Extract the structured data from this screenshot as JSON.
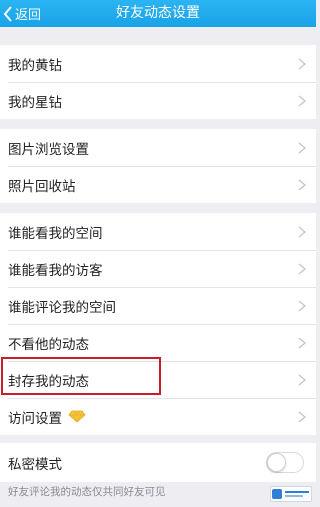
{
  "header": {
    "back_label": "返回",
    "title": "好友动态设置",
    "background_color": "#1fa9ee"
  },
  "groups": [
    {
      "items": [
        {
          "label": "我的黄钻"
        },
        {
          "label": "我的星钻"
        }
      ]
    },
    {
      "items": [
        {
          "label": "图片浏览设置"
        },
        {
          "label": "照片回收站"
        }
      ]
    },
    {
      "items": [
        {
          "label": "谁能看我的空间"
        },
        {
          "label": "谁能看我的访客"
        },
        {
          "label": "谁能评论我的空间"
        },
        {
          "label": "不看他的动态"
        },
        {
          "label": "封存我的动态",
          "highlighted": true
        },
        {
          "label": "访问设置",
          "icon": "diamond-icon"
        }
      ]
    },
    {
      "items": [
        {
          "label": "私密模式",
          "toggle": false
        }
      ]
    }
  ],
  "footnote": "好友评论我的动态仅共同好友可见",
  "highlight_color": "#c81e2c"
}
